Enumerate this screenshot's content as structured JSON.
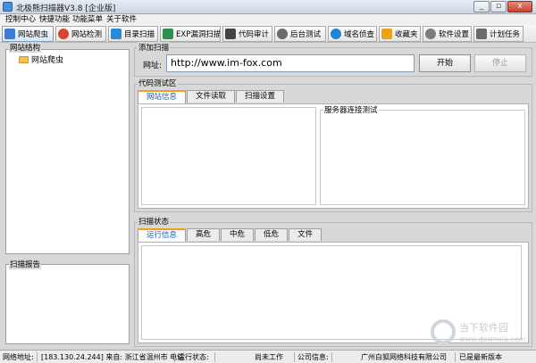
{
  "window": {
    "title": "北极熊扫描器V3.8 [企业版]",
    "minimize_glyph": "_",
    "restore_glyph": "▫",
    "close_glyph": "x"
  },
  "menu": [
    "控制中心",
    "快捷功能",
    "功能菜单",
    "关于软件"
  ],
  "toolbar": [
    {
      "label": "网站爬虫",
      "icon": "spider-icon",
      "color": "#3b7dd8"
    },
    {
      "label": "网站检测",
      "icon": "target-icon",
      "color": "#d9432f"
    },
    {
      "label": "目录扫描",
      "icon": "send-icon",
      "color": "#2a8ad4"
    },
    {
      "label": "EXP漏洞扫描",
      "icon": "exp-icon",
      "color": "#2f8f4e"
    },
    {
      "label": "代码审计",
      "icon": "code-icon",
      "color": "#444444"
    },
    {
      "label": "后台测试",
      "icon": "gauge-icon",
      "color": "#6a6a6a"
    },
    {
      "label": "域名侦查",
      "icon": "globe-icon",
      "color": "#1f86d0"
    },
    {
      "label": "收藏夹",
      "icon": "star-icon",
      "color": "#e8a317"
    },
    {
      "label": "软件设置",
      "icon": "gear-icon",
      "color": "#7d7d7d"
    },
    {
      "label": "计划任务",
      "icon": "calendar-icon",
      "color": "#6b6b6b"
    }
  ],
  "left": {
    "site_structure_label": "网站结构",
    "tree_root": "网站爬虫",
    "scan_report_label": "扫描报告"
  },
  "add_scan": {
    "group_label": "添加扫描",
    "url_label": "网址:",
    "url_value": "http://www.im-fox.com",
    "start_label": "开始",
    "stop_label": "停止"
  },
  "code_test": {
    "group_label": "代码测试区",
    "tabs": [
      "网站信息",
      "文件读取",
      "扫描设置"
    ],
    "server_test_label": "服务器连接测试"
  },
  "scan_status": {
    "group_label": "扫描状态",
    "tabs": [
      "运行信息",
      "高危",
      "中危",
      "低危",
      "文件"
    ]
  },
  "status": {
    "site_addr_label": "网络地址:",
    "ip_origin": "[183.130.24.244] 来自: 浙江省温州市 电信",
    "run_state_label": "运行状态:",
    "run_state": "尚未工作",
    "company_label": "公司信息:",
    "company": "广州白狐网络科技有限公司",
    "version_state": "已是最新版本"
  },
  "watermark": {
    "name": "当下软件园",
    "url": "www.downxia.com"
  }
}
